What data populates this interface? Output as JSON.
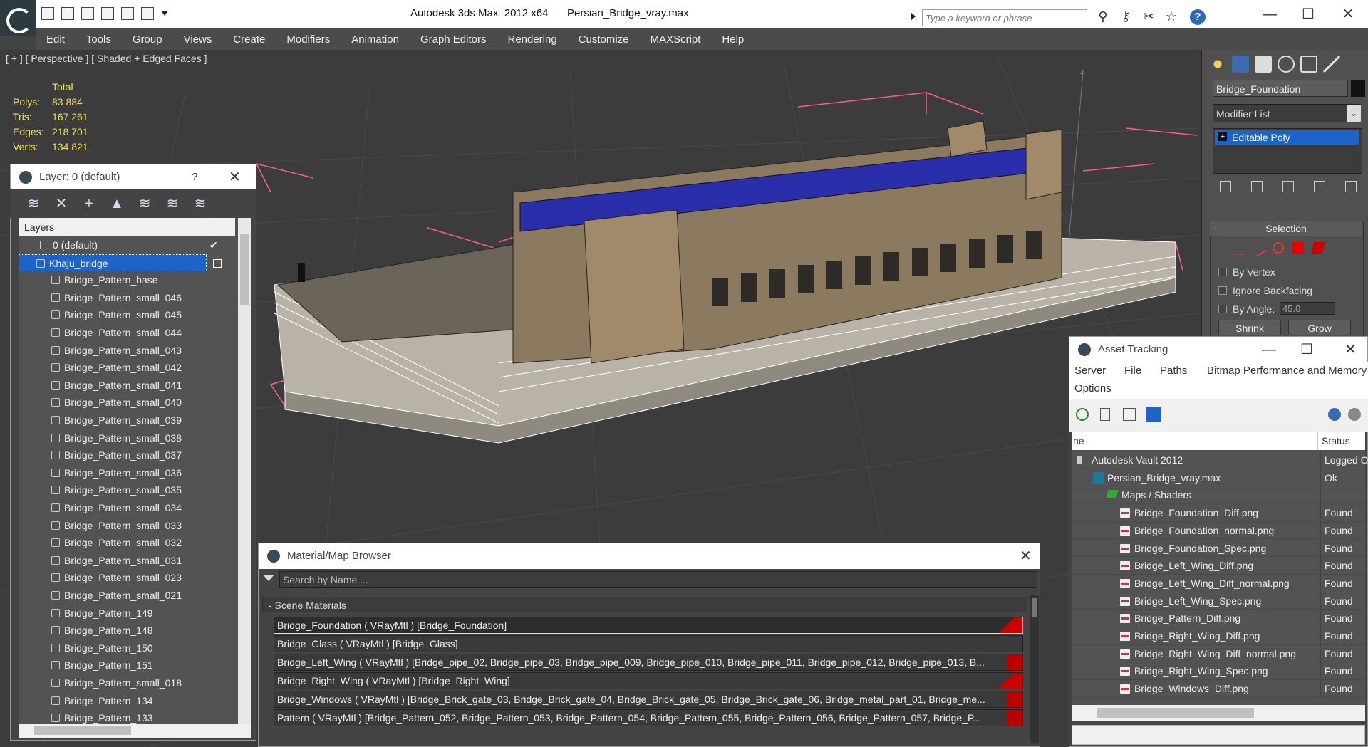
{
  "titlebar": {
    "app_title": "Autodesk 3ds Max  2012 x64",
    "doc_name": "Persian_Bridge_vray.max",
    "search_placeholder": "Type a keyword or phrase"
  },
  "menu": [
    "Edit",
    "Tools",
    "Group",
    "Views",
    "Create",
    "Modifiers",
    "Animation",
    "Graph Editors",
    "Rendering",
    "Customize",
    "MAXScript",
    "Help"
  ],
  "viewport": {
    "label": "[ + ] [ Perspective ] [ Shaded + Edged Faces ]",
    "stats_header": "Total",
    "stats": [
      {
        "key": "Polys:",
        "value": "83 884"
      },
      {
        "key": "Tris:",
        "value": "167 261"
      },
      {
        "key": "Edges:",
        "value": "218 701"
      },
      {
        "key": "Verts:",
        "value": "134 821"
      }
    ],
    "gizmo_label": "z"
  },
  "command_panel": {
    "object_name": "Bridge_Foundation",
    "modifier_list": "Modifier List",
    "stack_item": "Editable Poly",
    "selection": {
      "title": "Selection",
      "by_vertex": "By Vertex",
      "ignore_backfacing": "Ignore Backfacing",
      "by_angle": "By Angle:",
      "angle_value": "45.0",
      "shrink": "Shrink",
      "grow": "Grow"
    }
  },
  "layer_window": {
    "title": "Layer: 0 (default)",
    "help": "?",
    "column": "Layers",
    "rows": [
      "0 (default)",
      "Khaju_bridge",
      "Bridge_Pattern_base",
      "Bridge_Pattern_small_046",
      "Bridge_Pattern_small_045",
      "Bridge_Pattern_small_044",
      "Bridge_Pattern_small_043",
      "Bridge_Pattern_small_042",
      "Bridge_Pattern_small_041",
      "Bridge_Pattern_small_040",
      "Bridge_Pattern_small_039",
      "Bridge_Pattern_small_038",
      "Bridge_Pattern_small_037",
      "Bridge_Pattern_small_036",
      "Bridge_Pattern_small_035",
      "Bridge_Pattern_small_034",
      "Bridge_Pattern_small_033",
      "Bridge_Pattern_small_032",
      "Bridge_Pattern_small_031",
      "Bridge_Pattern_small_023",
      "Bridge_Pattern_small_021",
      "Bridge_Pattern_149",
      "Bridge_Pattern_148",
      "Bridge_Pattern_150",
      "Bridge_Pattern_151",
      "Bridge_Pattern_small_018",
      "Bridge_Pattern_134",
      "Bridge_Pattern_133"
    ]
  },
  "material_browser": {
    "title": "Material/Map Browser",
    "search_placeholder": "Search by Name ...",
    "section": "- Scene Materials",
    "rows": [
      "Bridge_Foundation  ( VRayMtl )  [Bridge_Foundation]",
      "Bridge_Glass  ( VRayMtl )  [Bridge_Glass]",
      "Bridge_Left_Wing  ( VRayMtl )  [Bridge_pipe_02, Bridge_pipe_03, Bridge_pipe_009, Bridge_pipe_010, Bridge_pipe_011, Bridge_pipe_012, Bridge_pipe_013, B...",
      "Bridge_Right_Wing  ( VRayMtl )  [Bridge_Right_Wing]",
      "Bridge_Windows  ( VRayMtl )  [Bridge_Brick_gate_03, Bridge_Brick_gate_04, Bridge_Brick_gate_05, Bridge_Brick_gate_06, Bridge_metal_part_01, Bridge_me...",
      "Pattern  ( VRayMtl )  [Bridge_Pattern_052, Bridge_Pattern_053, Bridge_Pattern_054, Bridge_Pattern_055, Bridge_Pattern_056, Bridge_Pattern_057, Bridge_P..."
    ]
  },
  "asset_tracking": {
    "title": "Asset Tracking",
    "menu": [
      "Server",
      "File",
      "Paths",
      "Bitmap Performance and Memory",
      "Options"
    ],
    "col_name": "ne",
    "col_status": "Status",
    "rows": [
      {
        "name": "Autodesk Vault 2012",
        "status": "Logged O"
      },
      {
        "name": "Persian_Bridge_vray.max",
        "status": "Ok"
      },
      {
        "name": "Maps / Shaders",
        "status": ""
      },
      {
        "name": "Bridge_Foundation_Diff.png",
        "status": "Found"
      },
      {
        "name": "Bridge_Foundation_normal.png",
        "status": "Found"
      },
      {
        "name": "Bridge_Foundation_Spec.png",
        "status": "Found"
      },
      {
        "name": "Bridge_Left_Wing_Diff.png",
        "status": "Found"
      },
      {
        "name": "Bridge_Left_Wing_Diff_normal.png",
        "status": "Found"
      },
      {
        "name": "Bridge_Left_Wing_Spec.png",
        "status": "Found"
      },
      {
        "name": "Bridge_Pattern_Diff.png",
        "status": "Found"
      },
      {
        "name": "Bridge_Right_Wing_Diff.png",
        "status": "Found"
      },
      {
        "name": "Bridge_Right_Wing_Diff_normal.png",
        "status": "Found"
      },
      {
        "name": "Bridge_Right_Wing_Spec.png",
        "status": "Found"
      },
      {
        "name": "Bridge_Windows_Diff.png",
        "status": "Found"
      }
    ]
  },
  "colors": {
    "accent": "#1e64c8",
    "stats_text": "#f0e060",
    "selection_box": "#ff5c8a",
    "viewport_bg": "#3c3c3c"
  }
}
